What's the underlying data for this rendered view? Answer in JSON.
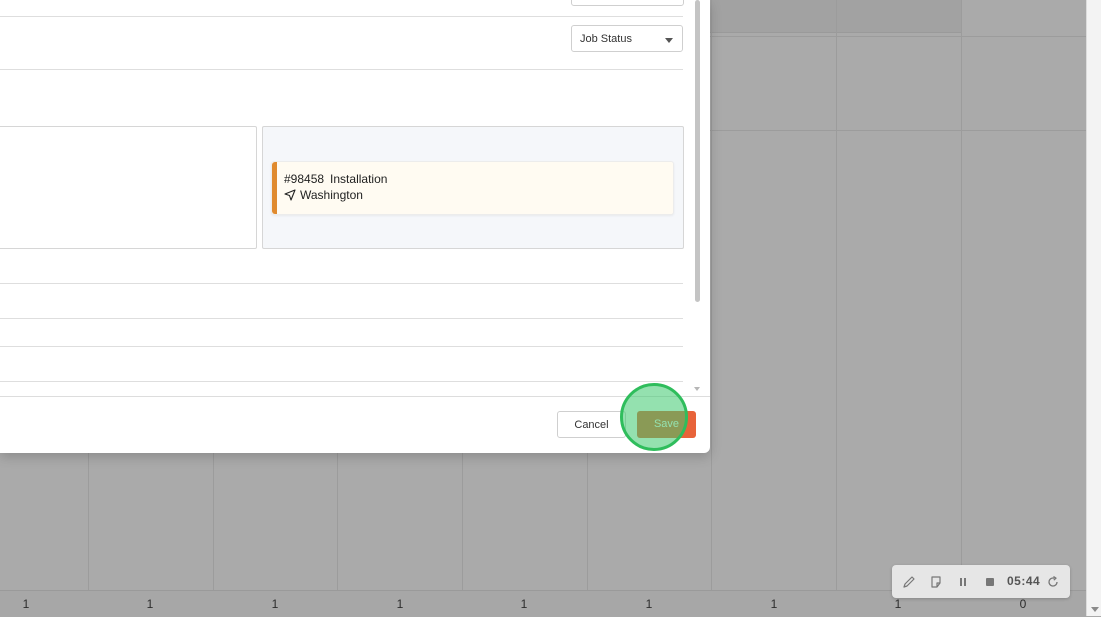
{
  "modal": {
    "status_select": {
      "label": "Job Status"
    },
    "job_card": {
      "number": "#98458",
      "type": "Installation",
      "location": "Washington",
      "accent_color": "#e08a2e"
    },
    "footer": {
      "cancel_label": "Cancel",
      "save_label": "Save",
      "save_color": "#e8633a"
    }
  },
  "schedule_counts": [
    "1",
    "1",
    "1",
    "1",
    "1",
    "1",
    "1",
    "1",
    "0"
  ],
  "recorder": {
    "time": "05:44",
    "icons": [
      "pencil-icon",
      "note-icon",
      "pause-icon",
      "stop-icon",
      "refresh-icon"
    ]
  }
}
